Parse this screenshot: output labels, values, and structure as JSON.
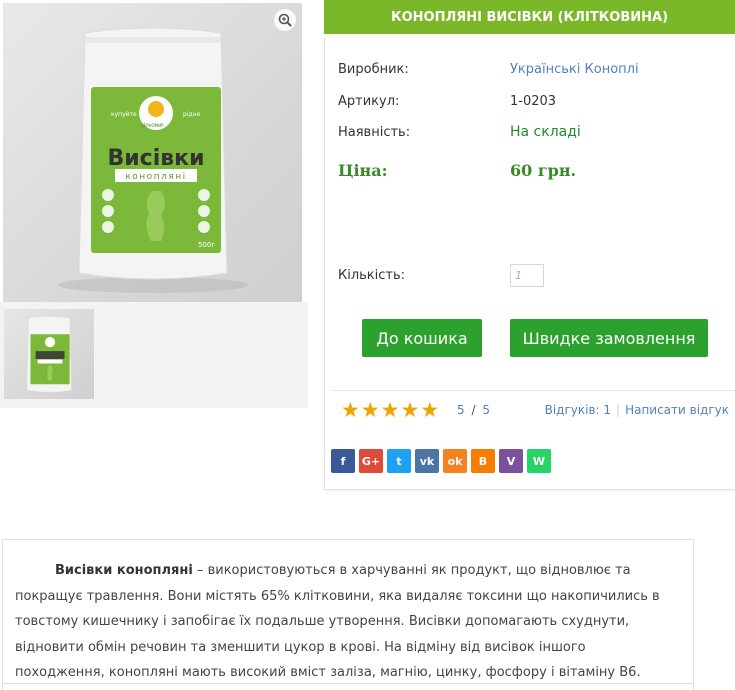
{
  "product": {
    "title": "КОНОПЛЯНІ ВИСІВКИ (КЛІТКОВИНА)",
    "image": {
      "brand_top": "купуйте",
      "brand_top_right": "рідне",
      "brand_ring": "ЗЕРНОМИР",
      "name": "Висівки",
      "subtitle": "конопляні",
      "weight": "500г"
    }
  },
  "details": {
    "manufacturer_label": "Виробник:",
    "manufacturer_value": "Українські Коноплі",
    "sku_label": "Артикул:",
    "sku_value": "1-0203",
    "availability_label": "Наявність:",
    "availability_value": "На складі",
    "price_label": "Ціна:",
    "price_value": "60 грн.",
    "qty_label": "Кількість:",
    "qty_placeholder": "1"
  },
  "actions": {
    "add_to_cart": "До кошика",
    "quick_order": "Швидке замовлення"
  },
  "rating": {
    "stars": 5,
    "score": "5",
    "slash": "/",
    "max": "5",
    "reviews_text": "Відгуків: 1",
    "write_review": "Написати відгук"
  },
  "social": [
    {
      "name": "facebook-icon",
      "glyph": "f",
      "color": "#3b5998"
    },
    {
      "name": "google-plus-icon",
      "glyph": "G+",
      "color": "#dd4b39"
    },
    {
      "name": "twitter-icon",
      "glyph": "t",
      "color": "#1da1f2"
    },
    {
      "name": "vk-icon",
      "glyph": "vk",
      "color": "#4c75a3"
    },
    {
      "name": "odnoklassniki-icon",
      "glyph": "ok",
      "color": "#f58220"
    },
    {
      "name": "blogger-icon",
      "glyph": "B",
      "color": "#f57d00"
    },
    {
      "name": "viber-icon",
      "glyph": "V",
      "color": "#7b519d"
    },
    {
      "name": "whatsapp-icon",
      "glyph": "W",
      "color": "#25d366"
    }
  ],
  "description": {
    "bold": "Висівки конопляні",
    "text": " – використовуються в харчуванні як продукт, що відновлює та покращує травлення. Вони містять 65% клітковини, яка видаляє токсини що накопичились в товстому кишечнику і запобігає їх подальше утворення. Висівки допомагають схуднути, відновити обмін речовин та зменшити цукор в крові. На відміну від висівок іншого походження, конопляні мають високий вміст заліза, магнію, цинку, фосфору і вітаміну В6."
  },
  "colors": {
    "accent_green": "#7ab829",
    "button_green": "#2da12d",
    "link_blue": "#5580b8",
    "star": "#f0a200"
  }
}
